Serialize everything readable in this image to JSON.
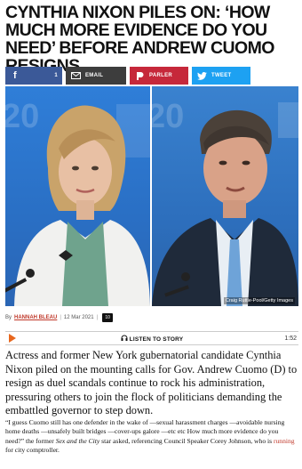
{
  "headline": "CYNTHIA NIXON PILES ON: ‘HOW MUCH MORE EVIDENCE DO YOU NEED’ BEFORE ANDREW CUOMO RESIGNS",
  "share": {
    "facebook_icon": "f",
    "facebook_count": "1",
    "email_label": "EMAIL",
    "parler_label": "PARLER",
    "tweet_label": "TWEET",
    "icons": [
      "facebook-icon",
      "mail-icon",
      "parler-icon",
      "twitter-icon"
    ],
    "colors": {
      "facebook": "#3b5998",
      "email": "#3d3d3d",
      "parler": "#c6283a",
      "twitter": "#1da1f2"
    }
  },
  "photo": {
    "credit": "Craig Ruttle-Pool/Getty Images",
    "left_logo": "20",
    "right_logo": "20"
  },
  "byline": {
    "prefix": "By",
    "author": "HANNAH BLEAU",
    "separator": "|",
    "date": "12 Mar 2021",
    "comments": "10"
  },
  "audio": {
    "label": "LISTEN TO STORY",
    "duration": "1:52"
  },
  "article": {
    "lead": "Actress and former New York gubernatorial candidate Cynthia Nixon piled on the mounting calls for Gov. Andrew Cuomo (D) to resign as duel scandals continue to rock his administration, pressuring others to join the flock of politicians demanding the embattled governor to step down.",
    "quote_part1": "“I guess Cuomo still has one defender in the wake of —sexual harassment charges —avoidable nursing home deaths —unsafely built bridges —cover-ups galore —etc etc How much more evidence do you need?” the former ",
    "show_title": "Sex and the City",
    "quote_part2": " star asked, referencing Council Speaker Corey Johnson, who is ",
    "link_text": "running",
    "quote_part3": " for city comptroller."
  }
}
